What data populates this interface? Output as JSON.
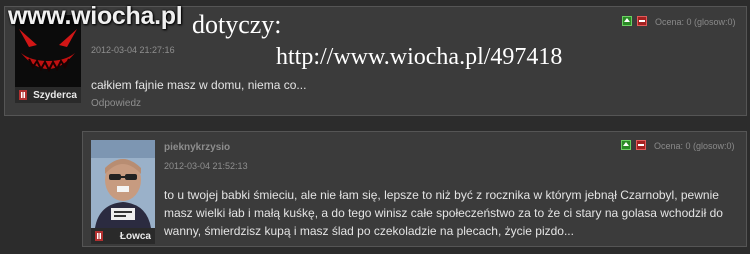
{
  "watermark": {
    "logo": "www.wiocha.pl",
    "label": "dotyczy:",
    "url": "http://www.wiocha.pl/497418"
  },
  "comments": [
    {
      "author": "",
      "date": "2012-03-04 21:27:16",
      "text": "całkiem fajnie masz w domu, niema co...",
      "rank": "Szyderca",
      "rating": "Ocena: 0 (glosow:0)",
      "reply": "Odpowiedz"
    },
    {
      "author": "pieknykrzysio",
      "date": "2012-03-04 21:52:13",
      "text_lines": [
        "to u twojej babki śmieciu, ale nie łam się, lepsze to niż być z rocznika w którym jebnął Czarnobyl, pewnie",
        "masz wielki łab i małą kuśkę, a do tego winisz całe społeczeństwo za to że ci stary na golasa wchodził do",
        "wanny, śmierdzisz kupą i masz ślad po czekoladzie na plecach, życie pizdo..."
      ],
      "rank": "Łowca",
      "rating": "Ocena: 0 (glosow:0)"
    }
  ],
  "colors": {
    "vote_up": "#2a8a25",
    "vote_down": "#a32020",
    "rank_icon": "#b23030"
  },
  "icons": [
    "vote-up-icon",
    "vote-down-icon",
    "rank-badge-icon"
  ]
}
